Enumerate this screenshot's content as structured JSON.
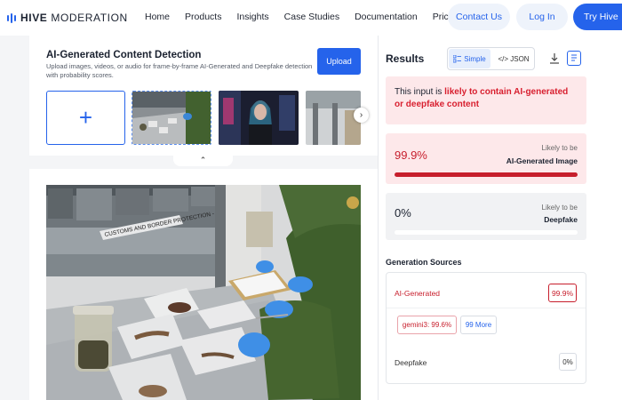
{
  "brand": {
    "name_bold": "HIVE",
    "name_rest": "MODERATION",
    "accent": "#2563eb"
  },
  "nav": {
    "links": [
      "Home",
      "Products",
      "Insights",
      "Case Studies",
      "Documentation",
      "Pricing"
    ],
    "contact": "Contact Us",
    "login": "Log In",
    "try": "Try Hive"
  },
  "detection": {
    "title": "AI-Generated Content Detection",
    "description": "Upload images, videos, or audio for frame-by-frame AI-Generated and Deepfake detection with probability scores.",
    "upload_label": "Upload",
    "add_icon": "plus-icon",
    "thumbnails": [
      "border-protection-lab",
      "neon-portrait",
      "warehouse-scene"
    ]
  },
  "results": {
    "title": "Results",
    "toggle": {
      "simple": "Simple",
      "json": "</> JSON"
    },
    "verdict_prefix": "This input is ",
    "verdict_highlight": "likely to contain AI-generated or deepfake content",
    "ai": {
      "percent": "99.9%",
      "likely": "Likely to be",
      "label": "AI-Generated Image",
      "fill": 0.999
    },
    "deepfake": {
      "percent": "0%",
      "likely": "Likely to be",
      "label": "Deepfake",
      "fill": 0
    },
    "sources_title": "Generation Sources",
    "sources": {
      "ai_label": "AI-Generated",
      "ai_value": "99.9%",
      "top_model": "gemini3: 99.6%",
      "more": "99 More",
      "deepfake_label": "Deepfake",
      "deepfake_value": "0%"
    },
    "colors": {
      "danger": "#c71e2c",
      "danger_bg": "#fde8ea"
    }
  },
  "image_sign": "CUSTOMS AND BORDER PROTECTION - EVIDENCE"
}
